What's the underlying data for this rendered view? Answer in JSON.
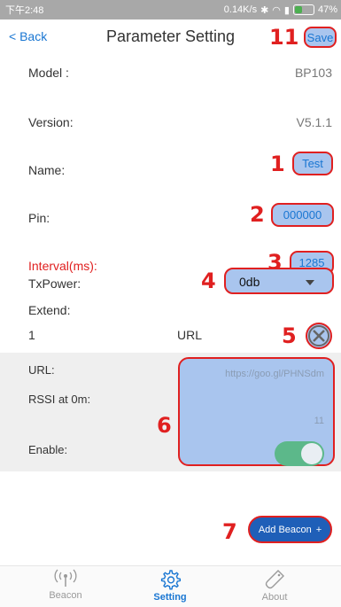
{
  "status_bar": {
    "time": "下午2:48",
    "net_speed": "0.14K/s",
    "battery": "47%",
    "battery_level": 0.47
  },
  "header": {
    "back_label": "< Back",
    "title": "Parameter Setting",
    "save_label": "Save"
  },
  "fields": {
    "model": {
      "label": "Model :",
      "value": "BP103"
    },
    "version": {
      "label": "Version:",
      "value": "V5.1.1"
    },
    "name": {
      "label": "Name:",
      "value": "Test"
    },
    "pin": {
      "label": "Pin:",
      "value": "000000"
    },
    "interval": {
      "label": "Interval(ms):",
      "value": "1285"
    },
    "txpower": {
      "label": "TxPower:",
      "value": "0db"
    },
    "extend": {
      "label": "Extend:"
    }
  },
  "beacon": {
    "index": "1",
    "type": "URL",
    "url_label": "URL:",
    "url_value": "https://goo.gl/PHNSdm",
    "rssi_label": "RSSI at 0m:",
    "rssi_value": "11",
    "enable_label": "Enable:",
    "enabled": true
  },
  "add_beacon_label": "Add Beacon",
  "callouts": [
    "1",
    "2",
    "3",
    "4",
    "5",
    "6",
    "7",
    "11"
  ],
  "tabs": [
    {
      "label": "Beacon",
      "icon": "beacon-icon"
    },
    {
      "label": "Setting",
      "icon": "gear-icon",
      "active": true
    },
    {
      "label": "About",
      "icon": "tag-icon"
    }
  ],
  "colors": {
    "accent": "#1976d2",
    "highlight": "#a9c5ee",
    "callout": "#e02020",
    "toggle_on": "#5cb88a",
    "add_button": "#1f5fb8"
  }
}
